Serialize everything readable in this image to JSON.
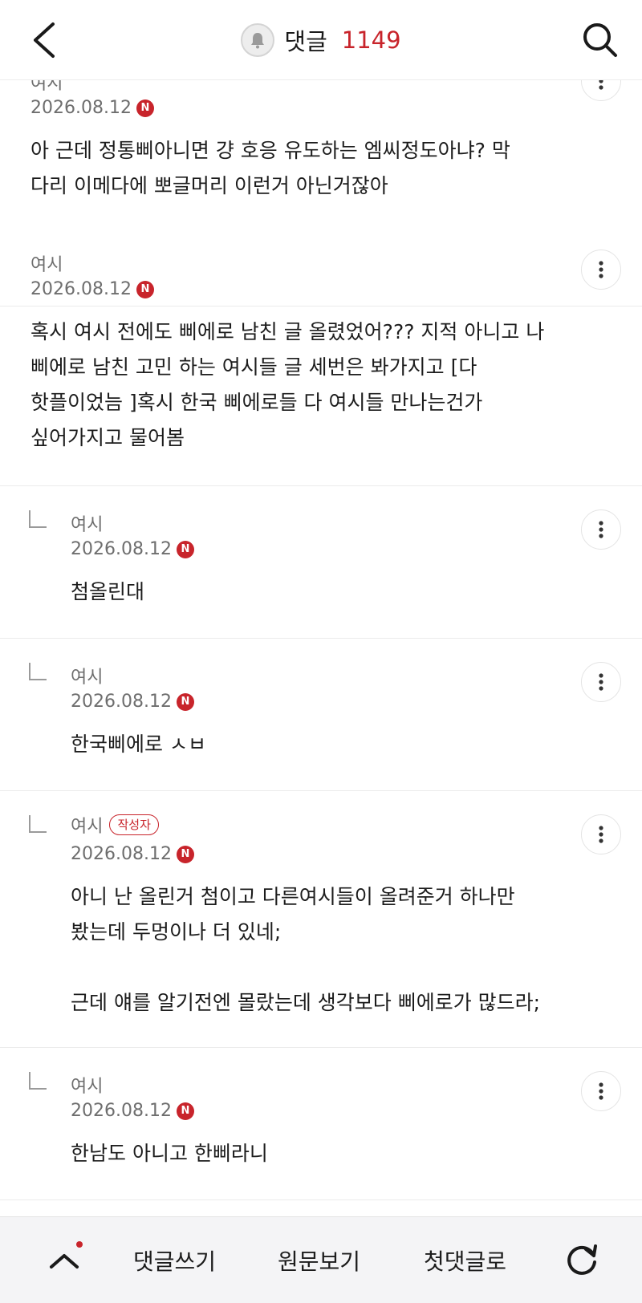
{
  "header": {
    "title": "댓글",
    "count": "1149"
  },
  "comments": [
    {
      "author": "여시",
      "date": "2026.08.12",
      "new_badge": "N",
      "body": "아 근데 정통삐아니면 걍 호응 유도하는 엠씨정도아냐? 막\n다리 이메다에 뽀글머리 이런거 아닌거잖아"
    },
    {
      "author": "여시",
      "date": "2026.08.12",
      "new_badge": "N",
      "body": "혹시 여시 전에도 삐에로 남친 글 올렸었어??? 지적 아니고 나\n삐에로 남친 고민 하는 여시들 글 세번은 봐가지고 [다\n핫플이었늠 ]혹시 한국 삐에로들 다 여시들 만나는건가\n싶어가지고 물어봄"
    },
    {
      "author": "여시",
      "date": "2026.08.12",
      "new_badge": "N",
      "body": "첨올린대"
    },
    {
      "author": "여시",
      "date": "2026.08.12",
      "new_badge": "N",
      "body": "한국삐에로 ㅅㅂ"
    },
    {
      "author": "여시",
      "author_badge": "작성자",
      "date": "2026.08.12",
      "new_badge": "N",
      "body": "아니 난 올린거 첨이고 다른여시들이 올려준거 하나만\n봤는데 두멍이나 더 있네;\n\n근데 얘를 알기전엔 몰랐는데 생각보다 삐에로가 많드라;"
    },
    {
      "author": "여시",
      "date": "2026.08.12",
      "new_badge": "N",
      "body": "한남도 아니고 한삐라니"
    }
  ],
  "bottom_bar": {
    "write_comment": "댓글쓰기",
    "view_original": "원문보기",
    "first_comment": "첫댓글로"
  },
  "colors": {
    "accent": "#c8242b",
    "muted_text": "#6e6e6e",
    "bottom_bar_bg": "#f4f4f6"
  },
  "icons": {
    "back": "chevron-left-icon",
    "bell": "bell-icon",
    "search": "search-icon",
    "more": "more-vertical-icon",
    "reply": "reply-corner-icon",
    "up": "chevron-up-icon",
    "refresh": "refresh-icon"
  }
}
